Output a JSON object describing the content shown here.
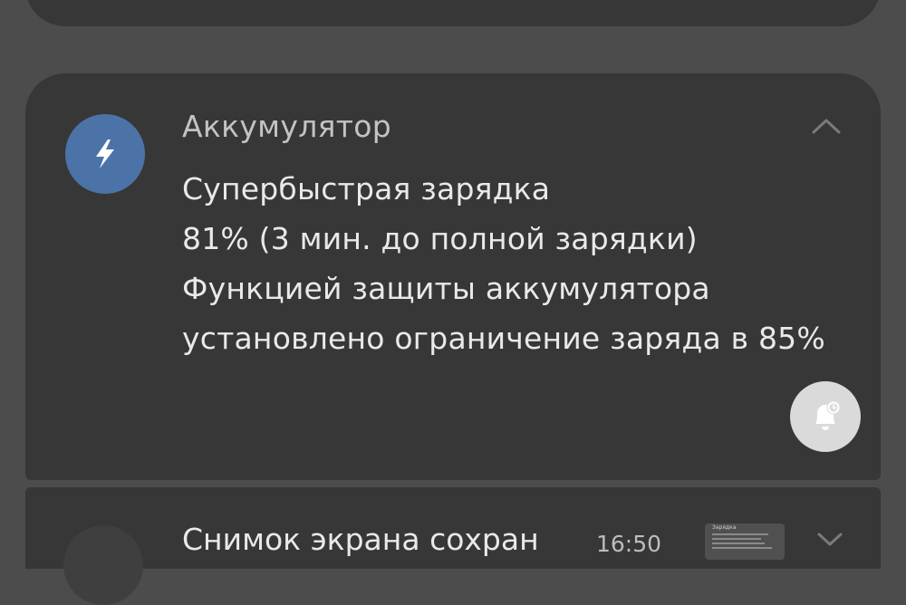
{
  "battery_notification": {
    "app_name": "Аккумулятор",
    "title": "Супербыстрая зарядка",
    "status": "81% (3 мин. до полной зарядки)",
    "protection_line1": "Функцией защиты аккумулятора",
    "protection_line2": "установлено ограничение заряда в 85%",
    "icon": "lightning-bolt-icon",
    "icon_color": "#4c73a8"
  },
  "screenshot_notification": {
    "title": "Снимок экрана сохран",
    "time": "16:50",
    "thumbnail_text": "Зарядка"
  },
  "colors": {
    "background": "#4c4c4c",
    "card": "#373737"
  }
}
